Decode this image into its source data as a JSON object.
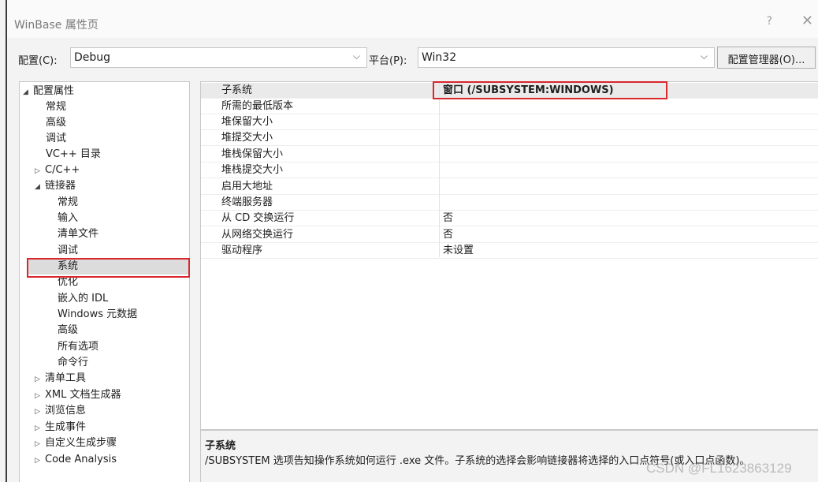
{
  "window": {
    "title": "WinBase 属性页",
    "help": "?",
    "close": "✕"
  },
  "toolbar": {
    "config_label": "配置(C):",
    "config_value": "Debug",
    "platform_label": "平台(P):",
    "platform_value": "Win32",
    "config_manager_label": "配置管理器(O)..."
  },
  "tree": [
    {
      "label": "配置属性",
      "expander": "◢",
      "level": 0
    },
    {
      "label": "常规",
      "expander": "",
      "level": 1
    },
    {
      "label": "高级",
      "expander": "",
      "level": 1
    },
    {
      "label": "调试",
      "expander": "",
      "level": 1
    },
    {
      "label": "VC++ 目录",
      "expander": "",
      "level": 1
    },
    {
      "label": "C/C++",
      "expander": "▷",
      "level": 1
    },
    {
      "label": "链接器",
      "expander": "◢",
      "level": 1
    },
    {
      "label": "常规",
      "expander": "",
      "level": 2
    },
    {
      "label": "输入",
      "expander": "",
      "level": 2
    },
    {
      "label": "清单文件",
      "expander": "",
      "level": 2
    },
    {
      "label": "调试",
      "expander": "",
      "level": 2
    },
    {
      "label": "系统",
      "expander": "",
      "level": 2,
      "selected": true
    },
    {
      "label": "优化",
      "expander": "",
      "level": 2
    },
    {
      "label": "嵌入的 IDL",
      "expander": "",
      "level": 2
    },
    {
      "label": "Windows 元数据",
      "expander": "",
      "level": 2
    },
    {
      "label": "高级",
      "expander": "",
      "level": 2
    },
    {
      "label": "所有选项",
      "expander": "",
      "level": 2
    },
    {
      "label": "命令行",
      "expander": "",
      "level": 2
    },
    {
      "label": "清单工具",
      "expander": "▷",
      "level": 1
    },
    {
      "label": "XML 文档生成器",
      "expander": "▷",
      "level": 1
    },
    {
      "label": "浏览信息",
      "expander": "▷",
      "level": 1
    },
    {
      "label": "生成事件",
      "expander": "▷",
      "level": 1
    },
    {
      "label": "自定义生成步骤",
      "expander": "▷",
      "level": 1
    },
    {
      "label": "Code Analysis",
      "expander": "▷",
      "level": 1
    }
  ],
  "properties": [
    {
      "name": "子系统",
      "value": "窗口 (/SUBSYSTEM:WINDOWS)",
      "selected": true
    },
    {
      "name": "所需的最低版本",
      "value": ""
    },
    {
      "name": "堆保留大小",
      "value": ""
    },
    {
      "name": "堆提交大小",
      "value": ""
    },
    {
      "name": "堆栈保留大小",
      "value": ""
    },
    {
      "name": "堆栈提交大小",
      "value": ""
    },
    {
      "name": "启用大地址",
      "value": ""
    },
    {
      "name": "终端服务器",
      "value": ""
    },
    {
      "name": "从 CD 交换运行",
      "value": "否"
    },
    {
      "name": "从网络交换运行",
      "value": "否"
    },
    {
      "name": "驱动程序",
      "value": "未设置"
    }
  ],
  "description": {
    "title": "子系统",
    "text": "/SUBSYSTEM 选项告知操作系统如何运行 .exe 文件。子系统的选择会影响链接器将选择的入口点符号(或入口点函数)。"
  },
  "watermark": "CSDN @FL1623863129",
  "colors": {
    "highlight_box": "#d9272e",
    "selection": "#dcdcdc"
  }
}
